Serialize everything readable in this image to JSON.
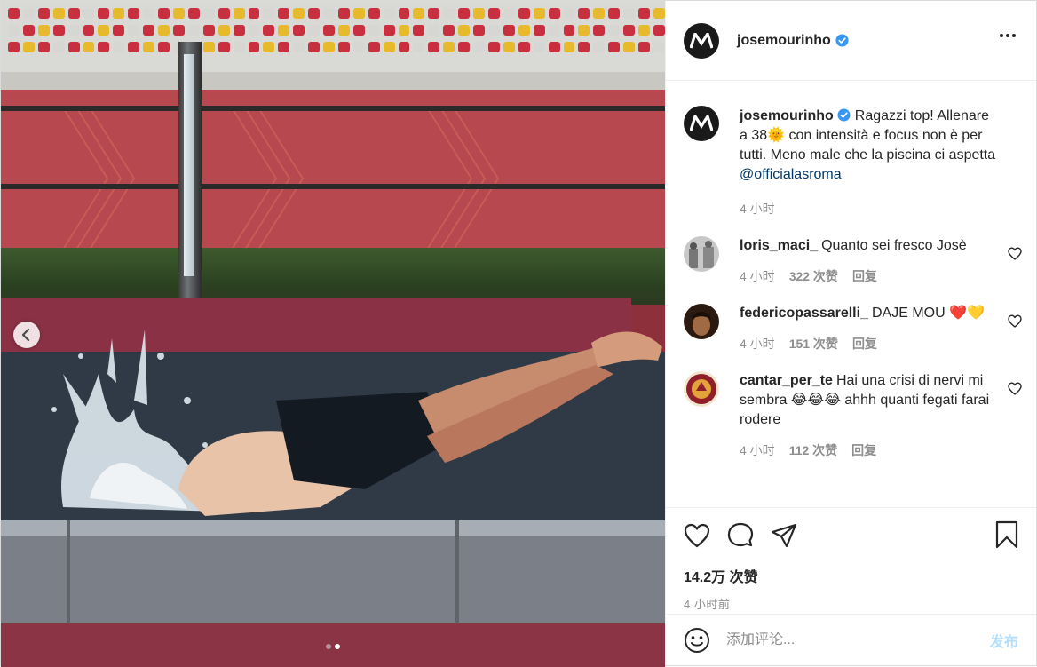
{
  "post": {
    "author": "josemourinho",
    "verified": true,
    "caption_text": "Ragazzi top! Allenare a 38🌞 con intensità e focus non è per tutti. Meno male che la piscina ci aspetta ",
    "caption_mention": "@officialasroma",
    "caption_time": "4 小时",
    "carousel": {
      "total": 2,
      "active": 2
    }
  },
  "comments": [
    {
      "user": "loris_maci_",
      "text": "Quanto sei fresco Josè",
      "time": "4 小时",
      "likes": "322 次赞",
      "reply": "回复"
    },
    {
      "user": "federicopassarelli_",
      "text": "DAJE MOU ❤️💛",
      "time": "4 小时",
      "likes": "151 次赞",
      "reply": "回复"
    },
    {
      "user": "cantar_per_te",
      "text": "Hai una crisi di nervi mi sembra 😂😂😂 ahhh quanti fegati farai rodere",
      "time": "4 小时",
      "likes": "112 次赞",
      "reply": "回复"
    }
  ],
  "stats": {
    "likes": "14.2万 次赞",
    "time": "4 小时前"
  },
  "composer": {
    "placeholder": "添加评论...",
    "publish": "发布"
  },
  "colors": {
    "verified": "#3897f0",
    "link": "#00376b",
    "muted": "#8e8e8e",
    "heart_red": "#ed4956",
    "publish_disabled": "#b2dffc"
  },
  "icons": [
    "more-icon",
    "heart-icon",
    "comment-icon",
    "share-icon",
    "bookmark-icon",
    "emoji-icon",
    "chevron-left-icon",
    "verified-icon"
  ]
}
